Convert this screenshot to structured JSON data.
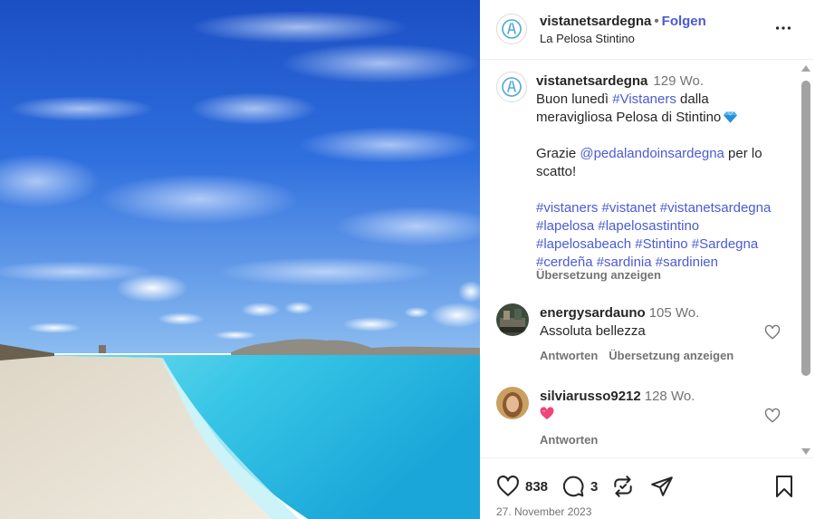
{
  "photo": {
    "alt_description": "",
    "colors": {
      "sky_top": "#1e56c8",
      "sky_bottom": "#6fa6ea",
      "sea": "#3fc9e3",
      "sand": "#e8e2d6"
    }
  },
  "header": {
    "username": "vistanetsardegna",
    "separator": "•",
    "follow_label": "Folgen",
    "location": "La Pelosa Stintino",
    "more_icon": "more-horizontal-icon"
  },
  "caption": {
    "username": "vistanetsardegna",
    "time": "129 Wo.",
    "line1_pre": "Buon lunedì ",
    "line1_tag": "#Vistaners",
    "line1_post": " dalla",
    "line2": "meravigliosa Pelosa di Stintino",
    "gem_icon": "gem-emoji-icon",
    "line4_pre": "Grazie ",
    "line4_mention": "@pedalandoinsardegna",
    "line4_post": " per lo",
    "line5": "scatto!",
    "hashtags": [
      "#vistaners #vistanet #vistanetsardegna",
      "#lapelosa #lapelosastintino",
      "#lapelosabeach #Stintino #Sardegna",
      "#cerdeña #sardinia #sardinien"
    ],
    "translate_label": "Übersetzung anzeigen"
  },
  "comments": [
    {
      "username": "energysardauno",
      "time": "105 Wo.",
      "text": "Assoluta bellezza",
      "reply_label": "Antworten",
      "translate_label": "Übersetzung anzeigen"
    },
    {
      "username": "silviarusso9212",
      "time": "128 Wo.",
      "text": "",
      "emoji_icon": "pink-heart-emoji-icon",
      "reply_label": "Antworten"
    }
  ],
  "actions": {
    "likes": "838",
    "comments": "3",
    "date": "27. November 2023"
  },
  "colors": {
    "link": "#4a5bd4",
    "text": "#262626",
    "secondary": "#737373",
    "heart_emoji": "#f0457a"
  }
}
